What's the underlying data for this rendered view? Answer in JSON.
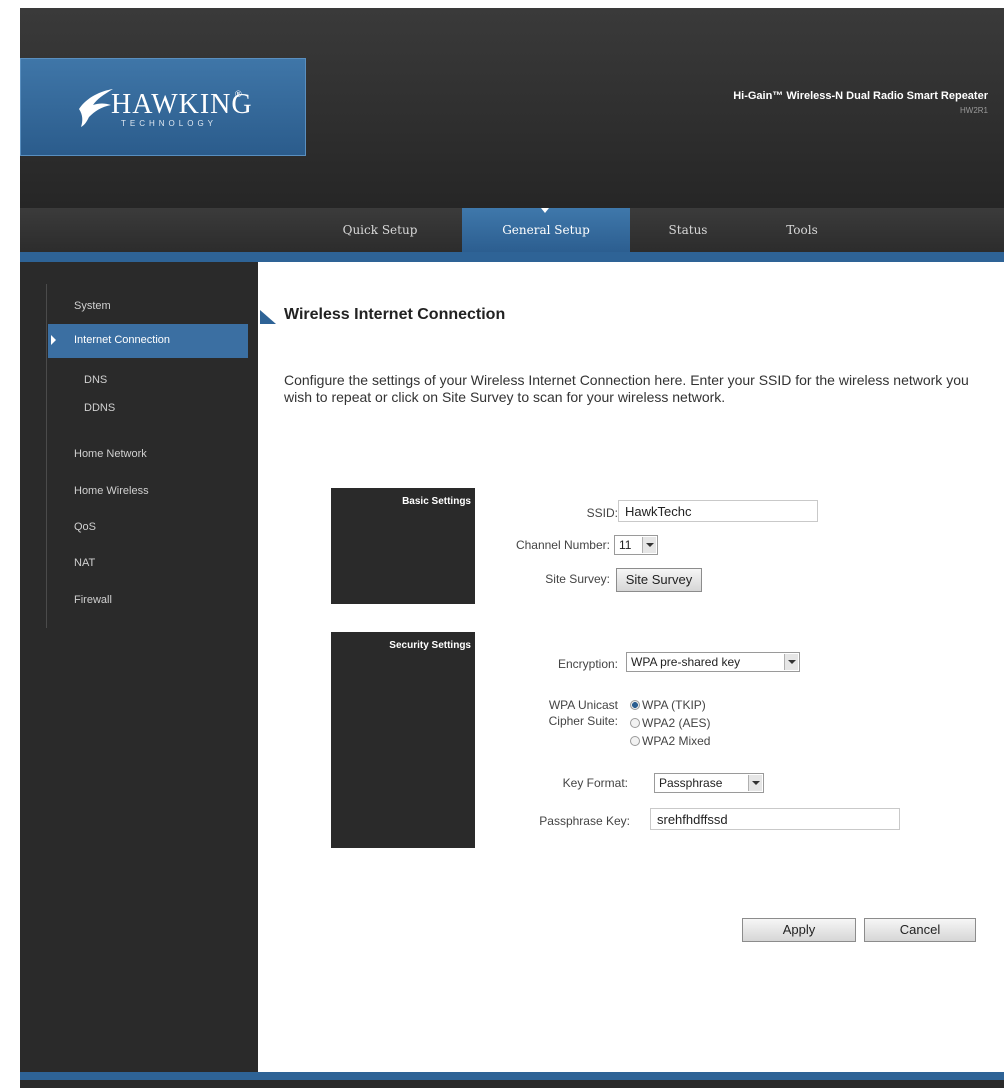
{
  "brand": {
    "logo_text": "HAWKING",
    "logo_sub": "TECHNOLOGY",
    "product_title": "Hi-Gain™ Wireless-N Dual Radio Smart Repeater",
    "product_model": "HW2R1"
  },
  "nav": {
    "tabs": [
      {
        "label": "Quick Setup"
      },
      {
        "label": "General Setup"
      },
      {
        "label": "Status"
      },
      {
        "label": "Tools"
      }
    ],
    "active_tab": "General Setup"
  },
  "sidebar": {
    "items": [
      {
        "label": "System"
      },
      {
        "label": "Internet Connection"
      },
      {
        "label": "DNS"
      },
      {
        "label": "DDNS"
      },
      {
        "label": "Home Network"
      },
      {
        "label": "Home Wireless"
      },
      {
        "label": "QoS"
      },
      {
        "label": "NAT"
      },
      {
        "label": "Firewall"
      }
    ],
    "active_item": "Internet Connection"
  },
  "page": {
    "title": "Wireless Internet Connection",
    "description": "Configure the settings of your Wireless Internet Connection here. Enter your SSID for the wireless network you wish to repeat or click on Site Survey to scan for your wireless network."
  },
  "basic": {
    "section_title": "Basic Settings",
    "ssid_label": "SSID:",
    "ssid_value": "HawkTechc",
    "channel_label": "Channel Number:",
    "channel_value": "11",
    "site_survey_label": "Site Survey:",
    "site_survey_button": "Site Survey"
  },
  "security": {
    "section_title": "Security Settings",
    "encryption_label": "Encryption:",
    "encryption_value": "WPA pre-shared key",
    "cipher_label_1": "WPA Unicast",
    "cipher_label_2": "Cipher Suite:",
    "cipher_options": [
      {
        "label": "WPA (TKIP)",
        "selected": true
      },
      {
        "label": "WPA2 (AES)",
        "selected": false
      },
      {
        "label": "WPA2 Mixed",
        "selected": false
      }
    ],
    "key_format_label": "Key Format:",
    "key_format_value": "Passphrase",
    "passphrase_label": "Passphrase Key:",
    "passphrase_value": "srehfhdffssd"
  },
  "actions": {
    "apply": "Apply",
    "cancel": "Cancel"
  },
  "colors": {
    "accent_blue": "#2e6396",
    "header_dark": "#2a2a2a"
  }
}
